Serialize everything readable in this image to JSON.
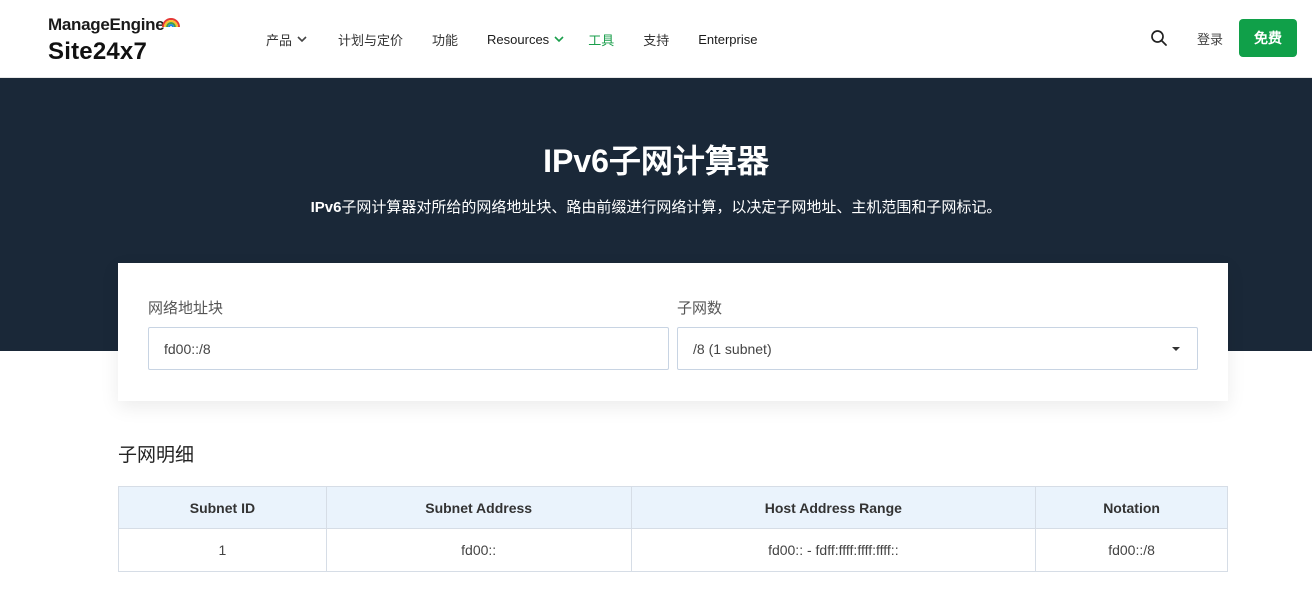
{
  "header": {
    "brand": "ManageEngine",
    "product": "Site24x7",
    "nav": [
      {
        "label": "产品",
        "has_dropdown": true
      },
      {
        "label": "计划与定价",
        "has_dropdown": false
      },
      {
        "label": "功能",
        "has_dropdown": false
      },
      {
        "label": "Resources",
        "has_dropdown": true
      },
      {
        "label": "工具",
        "has_dropdown": false,
        "active": true
      },
      {
        "label": "支持",
        "has_dropdown": false
      },
      {
        "label": "Enterprise",
        "has_dropdown": false
      }
    ],
    "login_label": "登录",
    "cta_label": "免费",
    "icons": {
      "search": "search-icon"
    }
  },
  "hero": {
    "title": "IPv6子网计算器",
    "desc_bold": "IPv6",
    "desc_rest": "子网计算器对所给的网络地址块、路由前缀进行网络计算，以决定子网地址、主机范围和子网标记。"
  },
  "form": {
    "network_label": "网络地址块",
    "network_value": "fd00::/8",
    "subnets_label": "子网数",
    "subnets_value": "/8 (1 subnet)"
  },
  "details": {
    "title": "子网明细",
    "columns": [
      "Subnet ID",
      "Subnet Address",
      "Host Address Range",
      "Notation"
    ],
    "rows": [
      [
        "1",
        "fd00::",
        "fd00:: - fdff:ffff:ffff:ffff::",
        "fd00::/8"
      ]
    ]
  },
  "colors": {
    "accent_green": "#10a049",
    "hero_bg": "#1a2838",
    "table_header_bg": "#eaf3fc"
  }
}
